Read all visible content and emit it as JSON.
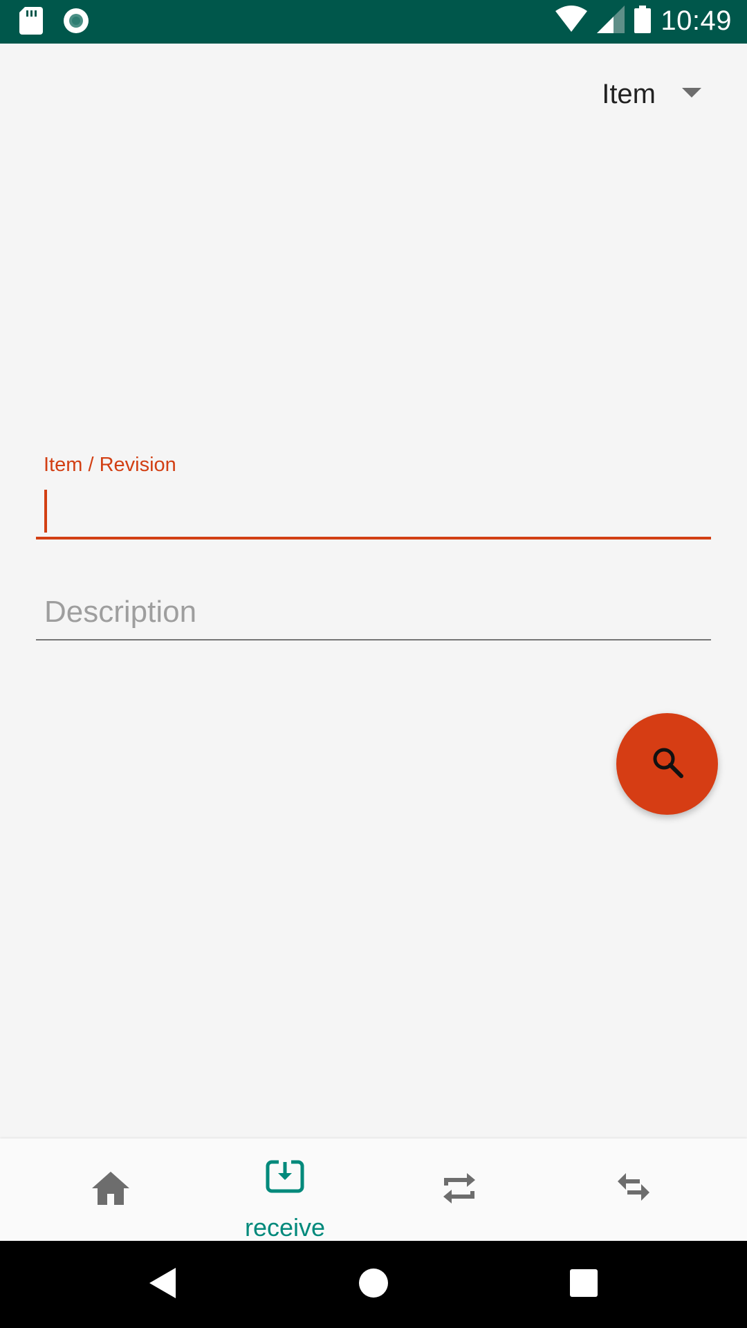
{
  "status_bar": {
    "time": "10:49",
    "icons": [
      "sd-card-icon",
      "record-icon",
      "wifi-icon",
      "signal-icon",
      "battery-icon"
    ],
    "background_color": "#00574b"
  },
  "dropdown": {
    "selected": "Item",
    "icon": "dropdown-arrow-icon"
  },
  "form": {
    "item_revision": {
      "label": "Item / Revision",
      "value": "",
      "focused": true,
      "accent_color": "#d23f13"
    },
    "description": {
      "placeholder": "Description",
      "value": ""
    }
  },
  "fab": {
    "icon": "search-icon",
    "color": "#d63d14"
  },
  "bottom_nav": {
    "items": [
      {
        "icon": "home-icon",
        "label": "",
        "active": false
      },
      {
        "icon": "receive-icon",
        "label": "receive",
        "active": true
      },
      {
        "icon": "repeat-icon",
        "label": "",
        "active": false
      },
      {
        "icon": "swap-horiz-icon",
        "label": "",
        "active": false
      }
    ],
    "active_color": "#00897b",
    "inactive_color": "#6d6d6d"
  },
  "system_nav": {
    "buttons": [
      "back-icon",
      "home-circle-icon",
      "recents-icon"
    ]
  }
}
